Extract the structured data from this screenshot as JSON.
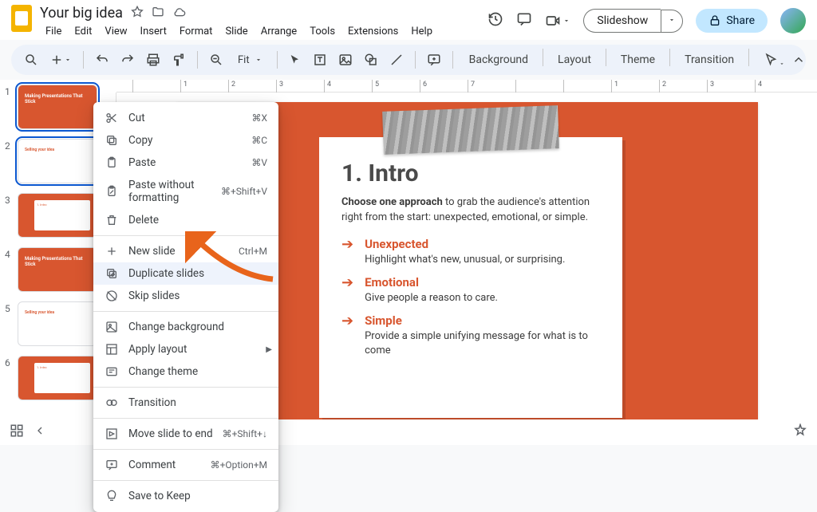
{
  "doc": {
    "title": "Your big idea"
  },
  "menubar": [
    "File",
    "Edit",
    "View",
    "Insert",
    "Format",
    "Slide",
    "Arrange",
    "Tools",
    "Extensions",
    "Help"
  ],
  "title_actions": {
    "slideshow": "Slideshow",
    "share": "Share"
  },
  "toolbar": {
    "zoom": "Fit",
    "tools": [
      "Background",
      "Layout",
      "Theme",
      "Transition"
    ]
  },
  "ruler_labels": [
    "",
    "1",
    "2",
    "3",
    "4",
    "5",
    "6",
    "7",
    "",
    "",
    "1",
    "2",
    "3",
    "4"
  ],
  "thumbs": [
    {
      "n": "1",
      "kind": "orange-title",
      "title": "Making Presentations That Stick",
      "selected": true
    },
    {
      "n": "2",
      "kind": "white-text",
      "title": "Selling your idea",
      "selected": true
    },
    {
      "n": "3",
      "kind": "card",
      "title": "1. Intro"
    },
    {
      "n": "4",
      "kind": "orange-title",
      "title": "Making Presentations That Stick"
    },
    {
      "n": "5",
      "kind": "white-text",
      "title": "Selling your idea"
    },
    {
      "n": "6",
      "kind": "card",
      "title": "1. Intro"
    }
  ],
  "slide": {
    "heading": "1. Intro",
    "lead_bold": "Choose one approach",
    "lead_rest": " to grab the audience's attention right from the start: unexpected, emotional, or simple.",
    "points": [
      {
        "title": "Unexpected",
        "text": "Highlight what's new, unusual, or surprising."
      },
      {
        "title": "Emotional",
        "text": "Give people a reason to care."
      },
      {
        "title": "Simple",
        "text": "Provide a simple unifying message for what is to come"
      }
    ]
  },
  "context_menu": [
    {
      "icon": "cut",
      "label": "Cut",
      "shortcut": "⌘X"
    },
    {
      "icon": "copy",
      "label": "Copy",
      "shortcut": "⌘C"
    },
    {
      "icon": "paste",
      "label": "Paste",
      "shortcut": "⌘V"
    },
    {
      "icon": "paste-nf",
      "label": "Paste without formatting",
      "shortcut": "⌘+Shift+V"
    },
    {
      "icon": "delete",
      "label": "Delete"
    },
    {
      "sep": true
    },
    {
      "icon": "plus",
      "label": "New slide",
      "shortcut": "Ctrl+M"
    },
    {
      "icon": "duplicate",
      "label": "Duplicate slides",
      "highlight": true
    },
    {
      "icon": "skip",
      "label": "Skip slides"
    },
    {
      "sep": true
    },
    {
      "icon": "bg",
      "label": "Change background"
    },
    {
      "icon": "layout",
      "label": "Apply layout",
      "submenu": true
    },
    {
      "icon": "theme",
      "label": "Change theme"
    },
    {
      "sep": true
    },
    {
      "icon": "transition",
      "label": "Transition"
    },
    {
      "sep": true
    },
    {
      "icon": "move-end",
      "label": "Move slide to end",
      "shortcut": "⌘+Shift+↓"
    },
    {
      "sep": true
    },
    {
      "icon": "comment",
      "label": "Comment",
      "shortcut": "⌘+Option+M"
    },
    {
      "sep": true
    },
    {
      "icon": "keep",
      "label": "Save to Keep"
    }
  ]
}
